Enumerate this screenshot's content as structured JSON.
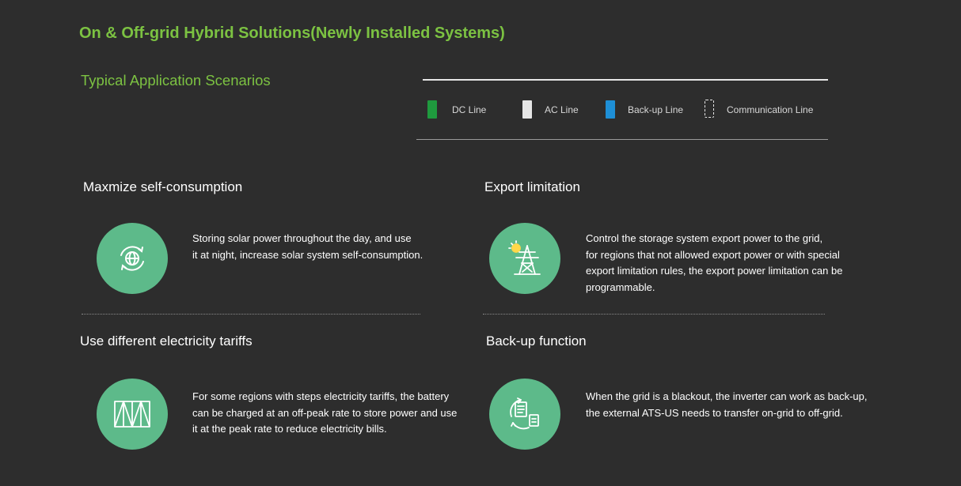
{
  "header": {
    "title": "On & Off-grid Hybrid Solutions(Newly Installed Systems)",
    "subtitle": "Typical Application Scenarios"
  },
  "legend": [
    {
      "label": "DC Line",
      "color": "#1f9a3e"
    },
    {
      "label": "AC Line",
      "color": "#e6e6e6"
    },
    {
      "label": "Back-up Line",
      "color": "#1e8fd6"
    },
    {
      "label": "Communication Line",
      "color": "#e6e6e6"
    }
  ],
  "colors": {
    "accent": "#7cc242",
    "circle": "#5dba8a",
    "background": "#2d2d2d"
  },
  "scenarios": [
    {
      "title": "Maxmize self-consumption",
      "icon": "globe-cycle-icon",
      "lines": [
        "Storing solar power throughout the day, and use",
        "it at night, increase solar system self-consumption."
      ]
    },
    {
      "title": "Export limitation",
      "icon": "solar-pylon-icon",
      "lines": [
        "Control the storage system export power to the grid,",
        "for regions that not allowed export power or with special",
        "export limitation rules, the export power limitation can be",
        "programmable."
      ]
    },
    {
      "title": "Use different electricity tariffs",
      "icon": "tariff-steps-icon",
      "lines": [
        "For some regions with steps electricity tariffs, the battery",
        "can be charged at an off-peak rate to store power and use",
        "it at the peak rate to reduce electricity bills."
      ]
    },
    {
      "title": "Back-up function",
      "icon": "document-transfer-icon",
      "lines": [
        "When the grid is a blackout, the inverter can work as back-up,",
        "the external ATS-US needs to transfer on-grid to off-grid."
      ]
    }
  ]
}
